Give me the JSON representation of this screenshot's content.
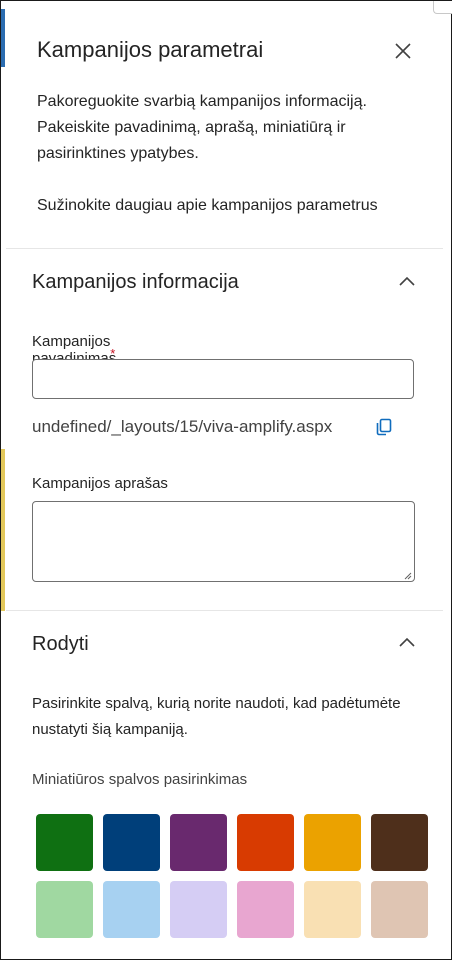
{
  "panel": {
    "title": "Kampanijos parametrai",
    "description": "Pakoreguokite svarbią kampanijos informaciją. Pakeiskite pavadinimą, aprašą, miniatiūrą ir pasirinktines ypatybes.",
    "learn_more": "Sužinokite daugiau apie kampanijos parametrus"
  },
  "info_section": {
    "title": "Kampanijos informacija",
    "name_label": "Kampanijos pavadinimas",
    "required_mark": "*",
    "name_value": "",
    "url_text": "undefined/_layouts/15/viva-amplify.aspx",
    "description_label": "Kampanijos aprašas",
    "description_value": ""
  },
  "display_section": {
    "title": "Rodyti",
    "description": "Pasirinkite spalvą, kurią norite naudoti, kad padėtumėte nustatyti šią kampaniją.",
    "swatch_label": "Miniatiūros spalvos pasirinkimas",
    "swatches": [
      "#0f7012",
      "#003f7a",
      "#69296e",
      "#d83b01",
      "#eba200",
      "#4e2f1b",
      "#a0d8a1",
      "#a7d1f1",
      "#d5cdf4",
      "#e8a6d0",
      "#f9e0b3",
      "#dfc5b3"
    ]
  }
}
